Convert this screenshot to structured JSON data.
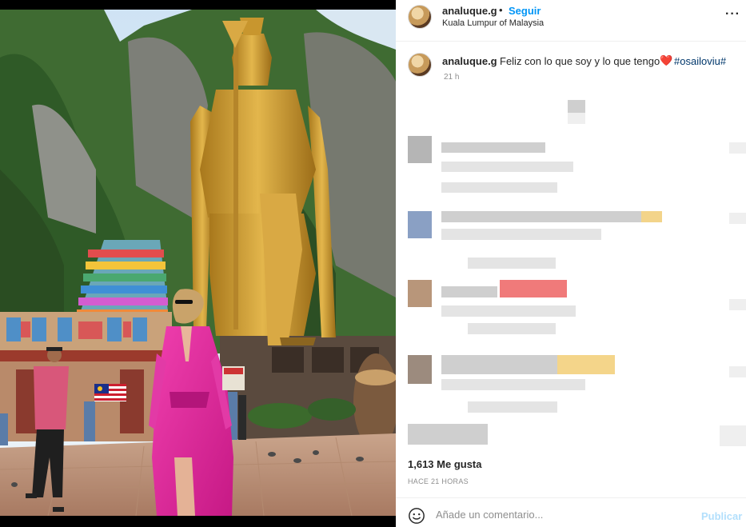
{
  "post": {
    "username": "analuque.g",
    "separator": "•",
    "follow_label": "Seguir",
    "location": "Kuala Lumpur of Malaysia",
    "more_label": "···"
  },
  "caption": {
    "username": "analuque.g",
    "text": "Feliz con lo que soy y lo que tengo",
    "emoji": "❤️",
    "hashtag": "#osailoviu#",
    "time": "21 h"
  },
  "footer": {
    "likes": "1,613 Me gusta",
    "time_ago": "HACE 21 HORAS",
    "comment_placeholder": "Añade un comentario...",
    "publish_label": "Publicar"
  },
  "icons": {
    "more": "more-options-icon",
    "emoji": "emoji-smiley-icon"
  },
  "colors": {
    "accent": "#0095f6",
    "publish_disabled": "#b2dffc",
    "hashtag": "#00376b",
    "muted": "#8e8e8e"
  }
}
